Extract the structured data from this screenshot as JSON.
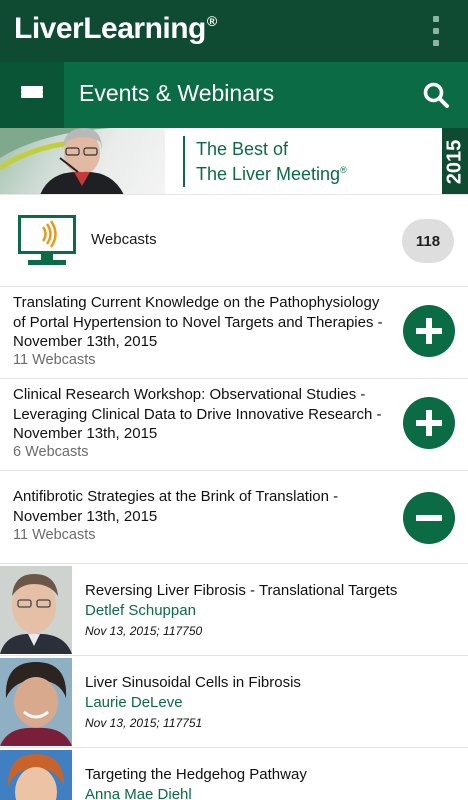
{
  "app": {
    "logo": "LiverLearning",
    "logo_mark": "®"
  },
  "toolbar": {
    "title": "Events & Webinars"
  },
  "banner": {
    "line1": "The Best of",
    "line2": "The Liver Meeting",
    "mark": "®",
    "year": "2015"
  },
  "webcasts": {
    "label": "Webcasts",
    "count": "118"
  },
  "sessions": [
    {
      "title": "Translating Current Knowledge on the Pathophysiology of Portal Hypertension to Novel Targets and Therapies - November 13th, 2015",
      "count": "11 Webcasts",
      "state": "expand"
    },
    {
      "title": "Clinical Research Workshop: Observational Studies - Leveraging Clinical Data to Drive Innovative Research - November 13th, 2015",
      "count": "6 Webcasts",
      "state": "expand"
    },
    {
      "title": "Antifibrotic Strategies at the Brink of Translation - November 13th, 2015",
      "count": "11 Webcasts",
      "state": "collapse"
    }
  ],
  "talks": [
    {
      "title": "Reversing Liver Fibrosis - Translational Targets",
      "speaker": "Detlef Schuppan",
      "meta": "Nov 13, 2015; 117750"
    },
    {
      "title": "Liver Sinusoidal Cells in Fibrosis",
      "speaker": "Laurie DeLeve",
      "meta": "Nov 13, 2015; 117751"
    },
    {
      "title": "Targeting the Hedgehog Pathway",
      "speaker": "Anna Mae Diehl",
      "meta": ""
    }
  ],
  "colors": {
    "appbar": "#0f4a33",
    "toolbar": "#0b6b45",
    "accent": "#0b6b45",
    "badge": "#dedede",
    "webcast_icon": "#e69a1c"
  },
  "icons": {
    "menu": "menu-icon",
    "search": "search-icon",
    "overflow": "overflow-menu-icon",
    "webcast": "monitor-broadcast-icon",
    "expand": "plus-icon",
    "collapse": "minus-icon"
  }
}
